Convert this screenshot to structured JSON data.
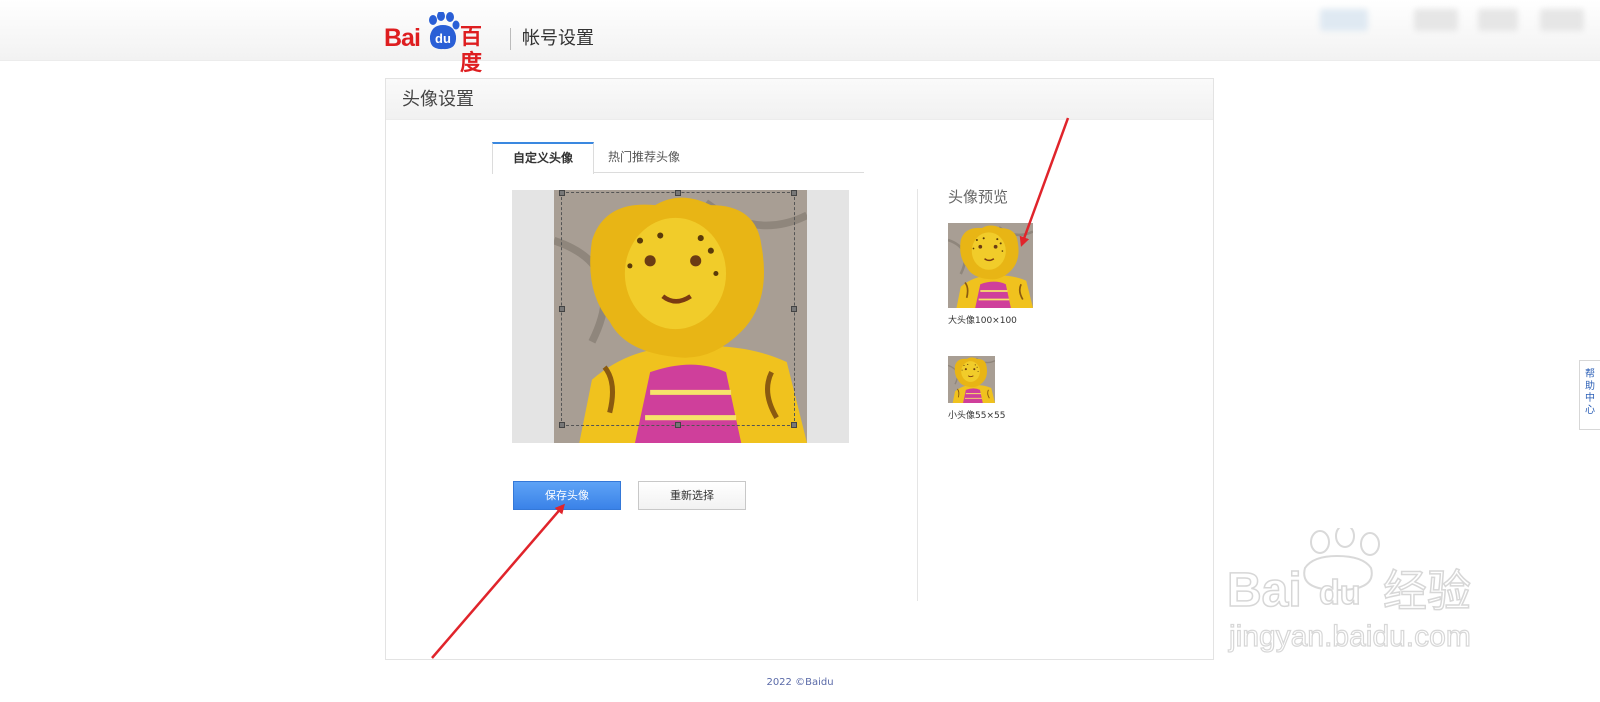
{
  "header": {
    "logo_text": "Bai",
    "logo_badge": "du",
    "logo_cn": "百度",
    "section_title": "帐号设置"
  },
  "panel": {
    "title": "头像设置",
    "tabs": [
      {
        "label": "自定义头像",
        "active": true
      },
      {
        "label": "热门推荐头像",
        "active": false
      }
    ],
    "buttons": {
      "save": "保存头像",
      "reselect": "重新选择"
    },
    "preview": {
      "title": "头像预览",
      "big_caption": "大头像100×100",
      "small_caption": "小头像55×55"
    }
  },
  "help": {
    "label": "帮助中心"
  },
  "footer": {
    "copyright": "2022 ©Baidu"
  },
  "watermark": {
    "brand_latin": "Bai",
    "brand_badge": "du",
    "brand_cn": "经验",
    "url": "jingyan.baidu.com"
  },
  "colors": {
    "accent": "#3a82e8",
    "brand_red": "#de1e20",
    "annotation_arrow": "#e0242b"
  }
}
